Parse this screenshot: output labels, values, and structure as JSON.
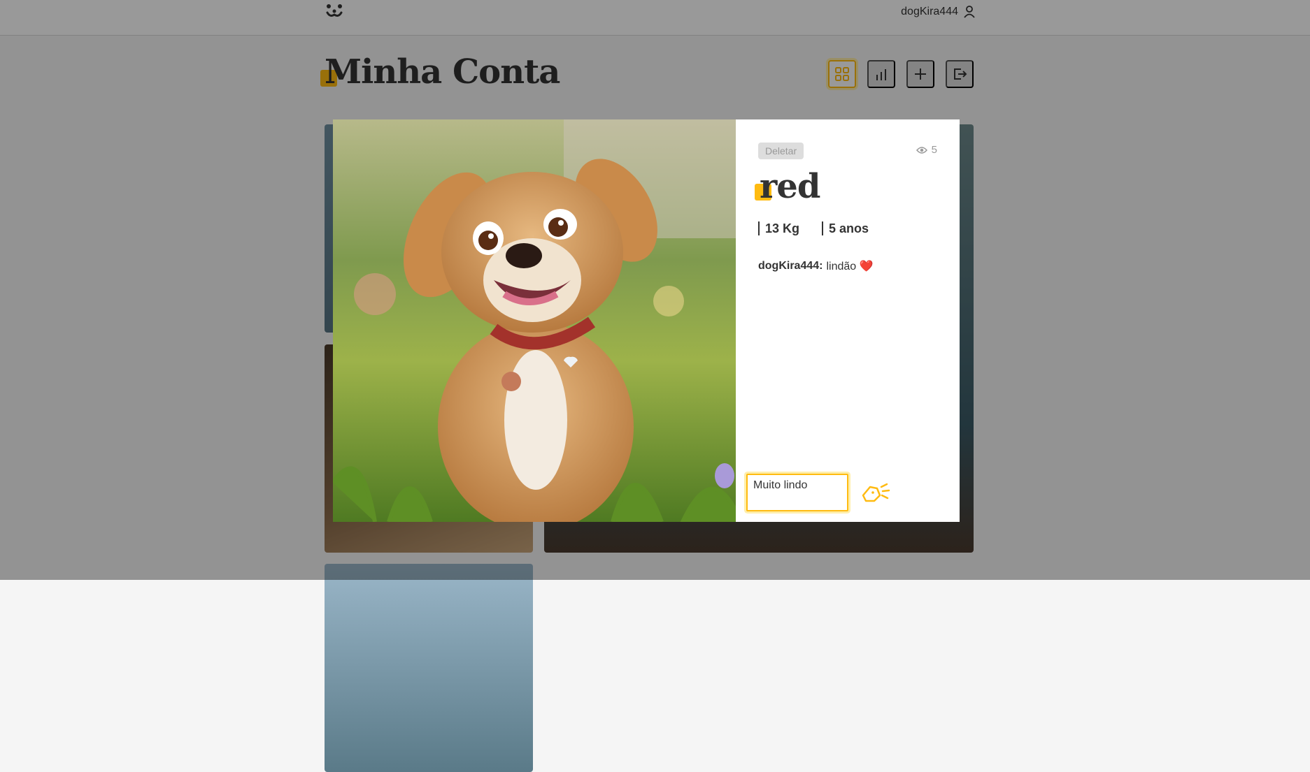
{
  "app": {
    "username": "dogKira444",
    "logo_icon": "dog-face-icon"
  },
  "page": {
    "title": "Minha Conta"
  },
  "nav": [
    {
      "name": "my-photos",
      "icon": "grid-icon",
      "active": true
    },
    {
      "name": "stats",
      "icon": "bar-chart-icon",
      "active": false
    },
    {
      "name": "add-photo",
      "icon": "plus-icon",
      "active": false
    },
    {
      "name": "logout",
      "icon": "logout-icon",
      "active": false
    }
  ],
  "colors": {
    "accent": "#ffbb11",
    "text": "#333333",
    "muted": "#999999"
  },
  "modal": {
    "delete_label": "Deletar",
    "views": "5",
    "photo_name": "red",
    "weight": "13 Kg",
    "age": "5 anos",
    "comments": [
      {
        "author": "dogKira444:",
        "text": "lindão ❤️"
      }
    ],
    "comment_input_value": "Muito lindo",
    "send_icon": "send-bark-icon"
  }
}
